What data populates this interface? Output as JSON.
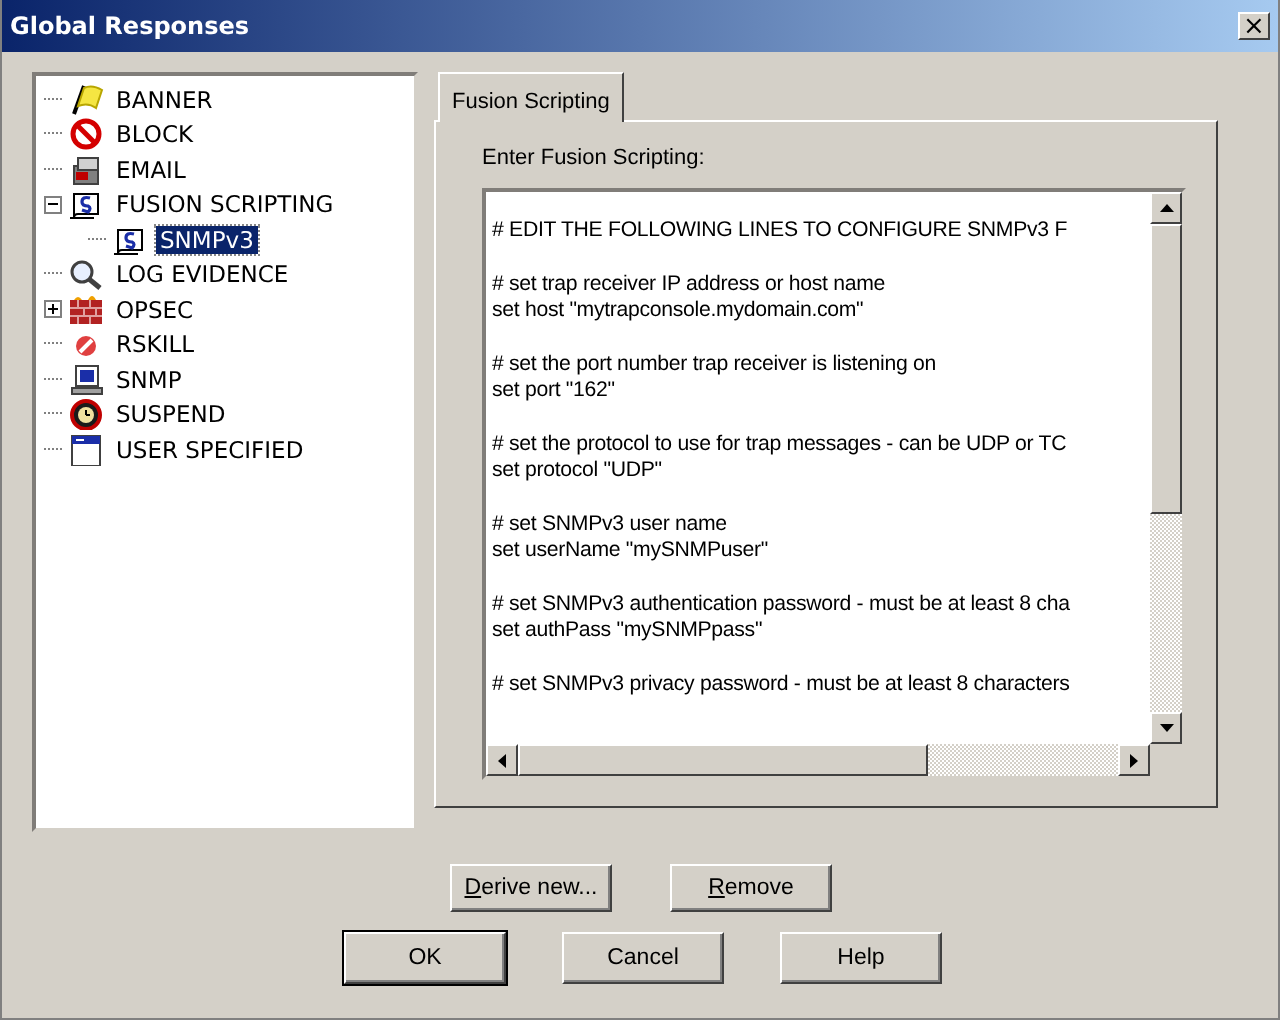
{
  "window": {
    "title": "Global Responses",
    "close": "×"
  },
  "tree": [
    {
      "label": "BANNER",
      "selected": false
    },
    {
      "label": "BLOCK",
      "selected": false
    },
    {
      "label": "EMAIL",
      "selected": false
    },
    {
      "label": "FUSION SCRIPTING",
      "selected": false,
      "expanded": true,
      "children": [
        {
          "label": "SNMPv3",
          "selected": true
        }
      ]
    },
    {
      "label": "LOG EVIDENCE",
      "selected": false
    },
    {
      "label": "OPSEC",
      "selected": false,
      "expanded": false
    },
    {
      "label": "RSKILL",
      "selected": false
    },
    {
      "label": "SNMP",
      "selected": false
    },
    {
      "label": "SUSPEND",
      "selected": false
    },
    {
      "label": "USER SPECIFIED",
      "selected": false
    }
  ],
  "tabs": [
    {
      "label": "Fusion Scripting",
      "selected": true
    }
  ],
  "editor": {
    "label": "Enter Fusion Scripting:",
    "paragraphs": [
      [
        "# EDIT THE FOLLOWING LINES TO CONFIGURE SNMPv3 F"
      ],
      [
        "# set trap receiver IP address or host name",
        "set host \"mytrapconsole.mydomain.com\""
      ],
      [
        "# set the port number trap receiver is listening on",
        "set port \"162\""
      ],
      [
        "# set the protocol to use for trap messages - can be UDP or TC",
        "set protocol \"UDP\""
      ],
      [
        "# set SNMPv3 user name",
        "set userName \"mySNMPuser\""
      ],
      [
        "# set SNMPv3 authentication password - must be at least 8 cha",
        "set authPass \"mySNMPpass\""
      ],
      [
        "# set SNMPv3 privacy password - must be at least 8 characters"
      ]
    ]
  },
  "tree_buttons": [
    {
      "label": "Derive new...",
      "first_letter_underlined": true
    },
    {
      "label": "Remove",
      "first_letter_underlined": true
    }
  ],
  "dialog_buttons": [
    {
      "label": "OK",
      "default": true
    },
    {
      "label": "Cancel",
      "default": false
    },
    {
      "label": "Help",
      "default": false
    }
  ]
}
